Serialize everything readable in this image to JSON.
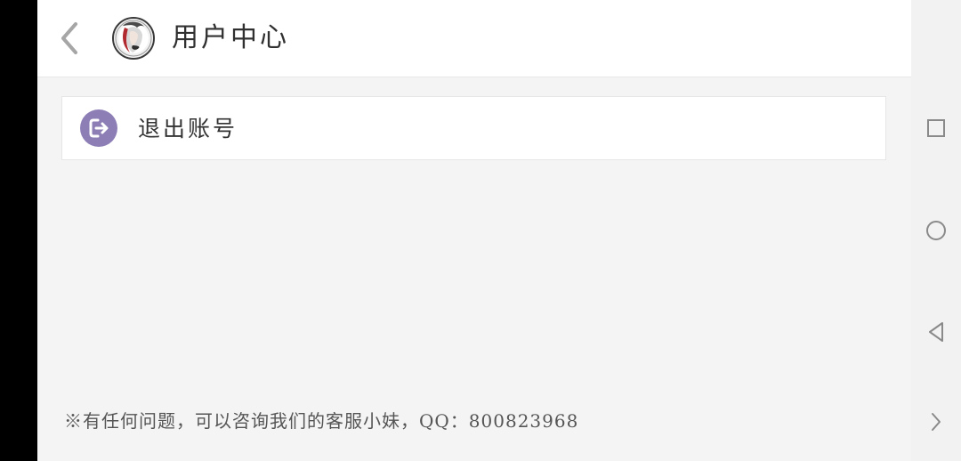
{
  "header": {
    "back_icon": "chevron-left-icon",
    "avatar": "user-avatar",
    "title": "用户中心"
  },
  "menu": {
    "logout": {
      "icon": "logout-icon",
      "icon_color": "#8d7fb6",
      "label": "退出账号"
    }
  },
  "footer": {
    "note": "※有任何问题，可以咨询我们的客服小妹，QQ：800823968"
  },
  "system_nav": {
    "buttons": [
      "square-icon",
      "circle-icon",
      "triangle-back-icon",
      "chevron-right-icon"
    ]
  }
}
